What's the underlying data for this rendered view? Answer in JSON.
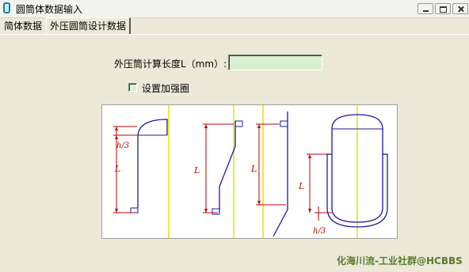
{
  "window": {
    "title": "圆筒体数据输入",
    "icon": "cylinder-app-icon",
    "controls": [
      "minimize",
      "maximize",
      "close"
    ]
  },
  "tabs": [
    {
      "label": "简体数据",
      "active": false
    },
    {
      "label": "外压圆筒设计数据",
      "active": true
    }
  ],
  "form": {
    "length_label": "外压筒计算长度L（mm）:",
    "length_value": "",
    "stiffening_ring_label": "设置加强圈",
    "stiffening_ring_checked": false
  },
  "diagram": {
    "labels": {
      "L": "L",
      "h3": "h/3"
    },
    "colors": {
      "vessel": "#1a1aa0",
      "dimension": "#c00000",
      "centerline": "#e8e000"
    }
  },
  "watermark": "化海川流-工业社群@HCBBS"
}
